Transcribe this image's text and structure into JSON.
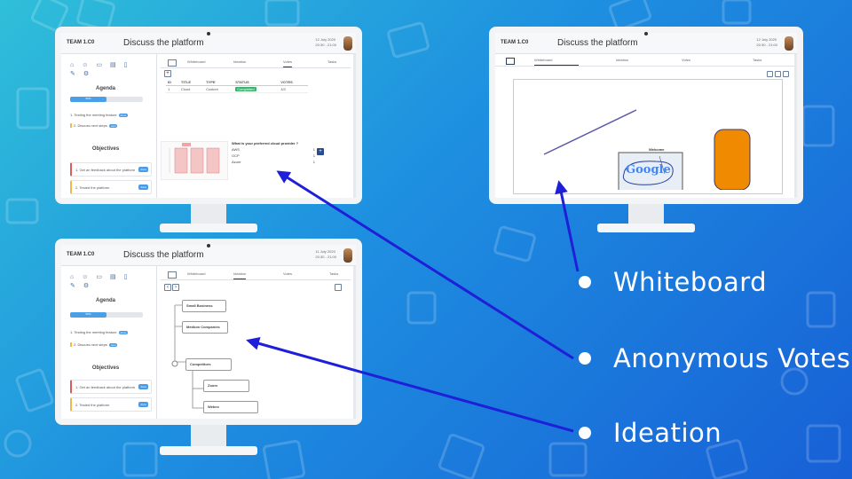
{
  "slide": {
    "bullets": [
      "Whiteboard",
      "Anonymous Votes",
      "Ideation"
    ]
  },
  "app": {
    "team": "TEAM 1.C0",
    "topic": "Discuss the platform",
    "date": "12 July 2020",
    "time": "20:30 - 21:00",
    "date2": "11 July 2020",
    "tabs": [
      "Whiteboard",
      "Ideation",
      "Votes",
      "Tasks"
    ],
    "agenda_title": "Agenda",
    "progress_label": "50%",
    "progress_value": 0.5,
    "agenda_items": [
      {
        "text": "1. Testing the meeting feature",
        "tag": "done"
      },
      {
        "text": "2. Discuss next steps",
        "tag": "next"
      }
    ],
    "objectives_title": "Objectives",
    "objectives": [
      {
        "text": "1. Get an feedback about the platform",
        "btn": "done"
      },
      {
        "text": "2. Tested the platform",
        "btn": "done"
      }
    ]
  },
  "votes": {
    "headers": [
      "ID",
      "TITLE",
      "TYPE",
      "STATUS",
      "VOTES"
    ],
    "rows": [
      [
        "1",
        "Cloud",
        "Custom",
        "Completed",
        "3/3"
      ]
    ],
    "poll_question": "What is your preferred cloud provider ?",
    "options": [
      {
        "name": "AWS",
        "votes": "1"
      },
      {
        "name": "GCP",
        "votes": "1"
      },
      {
        "name": "Azure",
        "votes": "1"
      }
    ]
  },
  "ideation": {
    "nodes": [
      "Small Business",
      "Medium Companies",
      "Competitors",
      "Zoom",
      "Webex"
    ]
  },
  "whiteboard": {
    "note": "Welcome",
    "logo": "Google"
  },
  "colors": {
    "arrow": "#1f1fd9",
    "accent": "#4a9be8",
    "orange": "#f08a00"
  }
}
